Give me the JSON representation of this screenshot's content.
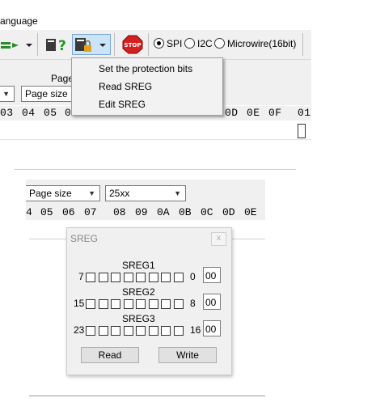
{
  "menubar": {
    "language_label": "anguage"
  },
  "toolbar": {
    "stop_label": "STOP",
    "protocols": [
      {
        "label": "SPI",
        "selected": true
      },
      {
        "label": "I2C",
        "selected": false
      },
      {
        "label": "Microwire(16bit)",
        "selected": false
      }
    ]
  },
  "panel": {
    "page_label": "Page",
    "page_size_value": "Page size"
  },
  "hex_header": [
    "03",
    "04",
    "05",
    "0",
    "0D",
    "0E",
    "0F",
    "01"
  ],
  "popup_menu": {
    "items": [
      "Set the protection bits",
      "Read SREG",
      "Edit SREG"
    ]
  },
  "panel2": {
    "page_size_value": "Page size",
    "chip_value": "25xx"
  },
  "hex_header2": [
    "4",
    "05",
    "06",
    "07",
    "08",
    "09",
    "0A",
    "0B",
    "0C",
    "0D",
    "0E"
  ],
  "dialog": {
    "title": "SREG",
    "close_label": "x",
    "registers": [
      {
        "name": "SREG1",
        "high": "7",
        "low": "0",
        "value": "00"
      },
      {
        "name": "SREG2",
        "high": "15",
        "low": "8",
        "value": "00"
      },
      {
        "name": "SREG3",
        "high": "23",
        "low": "16",
        "value": "00"
      }
    ],
    "read_label": "Read",
    "write_label": "Write"
  }
}
